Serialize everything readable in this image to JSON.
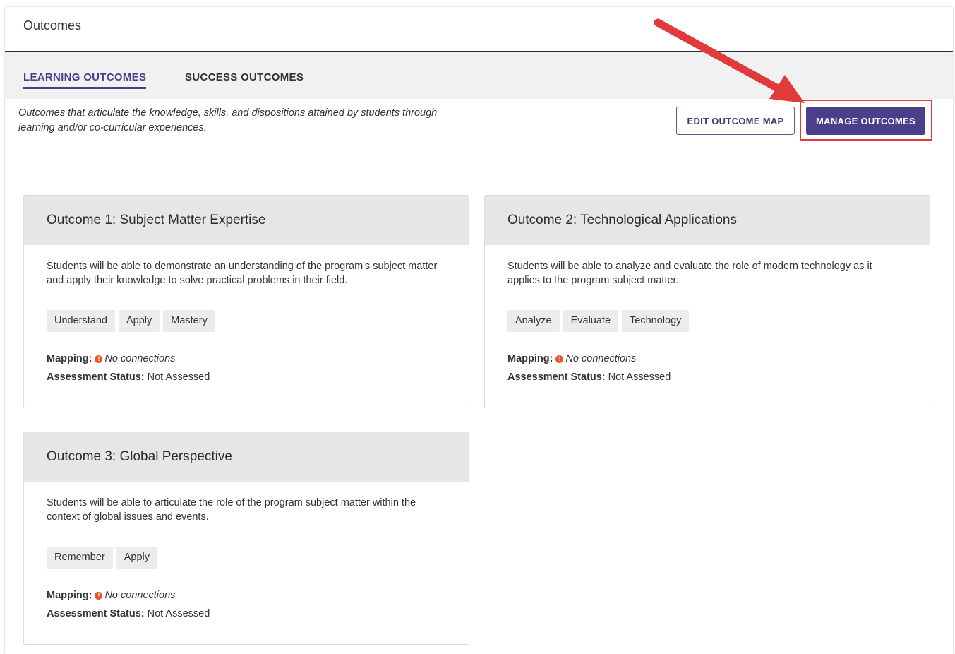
{
  "header": {
    "title": "Outcomes"
  },
  "tabs": [
    {
      "label": "LEARNING OUTCOMES",
      "active": true
    },
    {
      "label": "SUCCESS OUTCOMES",
      "active": false
    }
  ],
  "description": "Outcomes that articulate the knowledge, skills, and dispositions attained by students through learning and/or co-curricular experiences.",
  "buttons": {
    "edit_map": "EDIT OUTCOME MAP",
    "manage": "MANAGE OUTCOMES"
  },
  "labels": {
    "mapping": "Mapping:",
    "assessment_status": "Assessment Status:"
  },
  "outcomes": [
    {
      "title": "Outcome 1: Subject Matter Expertise",
      "text": "Students will be able to demonstrate an understanding of the program's subject matter and apply their knowledge to solve practical problems in their field.",
      "tags": [
        "Understand",
        "Apply",
        "Mastery"
      ],
      "mapping": "No connections",
      "status": "Not Assessed"
    },
    {
      "title": "Outcome 2: Technological Applications",
      "text": "Students will be able to analyze and evaluate the role of modern technology as it applies to the program subject matter.",
      "tags": [
        "Analyze",
        "Evaluate",
        "Technology"
      ],
      "mapping": "No connections",
      "status": "Not Assessed"
    },
    {
      "title": "Outcome 3: Global Perspective",
      "text": "Students will be able to articulate the role of the program subject matter within the context of global issues and events.",
      "tags": [
        "Remember",
        "Apply"
      ],
      "mapping": "No connections",
      "status": "Not Assessed"
    }
  ],
  "colors": {
    "accent": "#4b3f8c",
    "annotation": "#e03a3a",
    "warning": "#e8562a"
  }
}
